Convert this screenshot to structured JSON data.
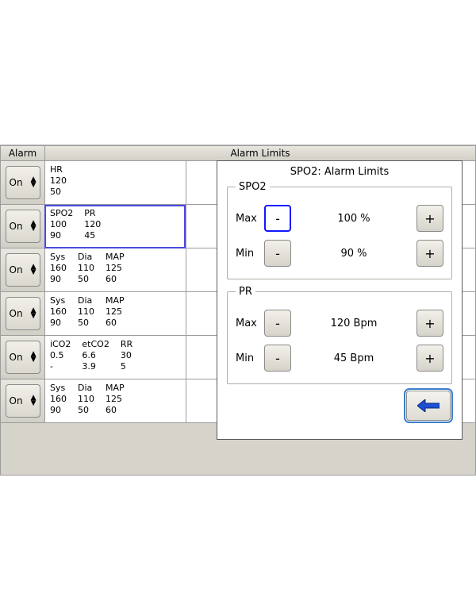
{
  "headers": {
    "alarm": "Alarm",
    "limits": "Alarm Limits"
  },
  "on_label": "On",
  "rows": [
    {
      "cols": [
        {
          "h": "HR",
          "hi": "120",
          "lo": "50"
        }
      ]
    },
    {
      "selected": true,
      "cols": [
        {
          "h": "SPO2",
          "hi": "100",
          "lo": "90"
        },
        {
          "h": "PR",
          "hi": "120",
          "lo": "45"
        }
      ]
    },
    {
      "cols": [
        {
          "h": "Sys",
          "hi": "160",
          "lo": "90"
        },
        {
          "h": "Dia",
          "hi": "110",
          "lo": "50"
        },
        {
          "h": "MAP",
          "hi": "125",
          "lo": "60"
        }
      ]
    },
    {
      "cols": [
        {
          "h": "Sys",
          "hi": "160",
          "lo": "90"
        },
        {
          "h": "Dia",
          "hi": "110",
          "lo": "50"
        },
        {
          "h": "MAP",
          "hi": "125",
          "lo": "60"
        }
      ]
    },
    {
      "cols": [
        {
          "h": "iCO2",
          "hi": "0.5",
          "lo": "-"
        },
        {
          "h": "etCO2",
          "hi": "6.6",
          "lo": "3.9"
        },
        {
          "h": "RR",
          "hi": "30",
          "lo": "5"
        }
      ]
    },
    {
      "cols": [
        {
          "h": "Sys",
          "hi": "160",
          "lo": "90"
        },
        {
          "h": "Dia",
          "hi": "110",
          "lo": "50"
        },
        {
          "h": "MAP",
          "hi": "125",
          "lo": "60"
        }
      ]
    }
  ],
  "popup": {
    "title": "SPO2: Alarm Limits",
    "groups": [
      {
        "legend": "SPO2",
        "rows": [
          {
            "label": "Max",
            "value": "100 %",
            "focus_minus": true
          },
          {
            "label": "Min",
            "value": "90 %"
          }
        ]
      },
      {
        "legend": "PR",
        "rows": [
          {
            "label": "Max",
            "value": "120 Bpm"
          },
          {
            "label": "Min",
            "value": "45 Bpm"
          }
        ]
      }
    ],
    "minus": "-",
    "plus": "+"
  }
}
